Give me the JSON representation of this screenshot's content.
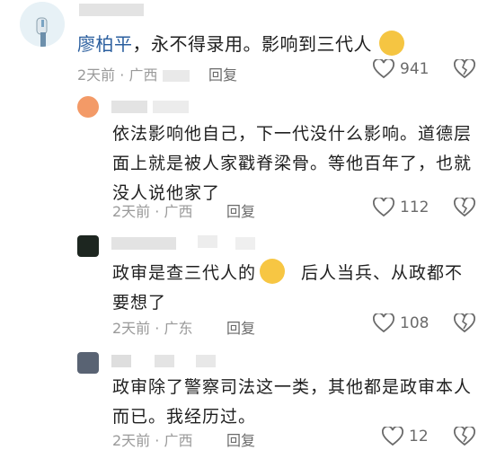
{
  "comments": [
    {
      "mention": "廖柏平",
      "text": "，永不得录用。影响到三代人",
      "time": "2天前",
      "sep": "·",
      "location": "广西",
      "reply": "回复",
      "likes": "941"
    },
    {
      "text": "依法影响他自己，下一代没什么影响。道德层面上就是被人家戳脊梁骨。等他百年了，也就没人说他家了",
      "time": "2天前",
      "sep": "·",
      "location": "广西",
      "reply": "回复",
      "likes": "112"
    },
    {
      "text_a": "政审是查三代人的",
      "text_b": "后人当兵、从政都不要想了",
      "time": "2天前",
      "sep": "·",
      "location": "广东",
      "reply": "回复",
      "likes": "108"
    },
    {
      "text": "政审除了警察司法这一类，其他都是政审本人而已。我经历过。",
      "time": "2天前",
      "sep": "·",
      "location": "广西",
      "reply": "回复",
      "likes": "12"
    }
  ],
  "colors": {
    "mention": "#2a5e9e",
    "meta": "#9a9a9a",
    "emoji": "#f7c643"
  }
}
